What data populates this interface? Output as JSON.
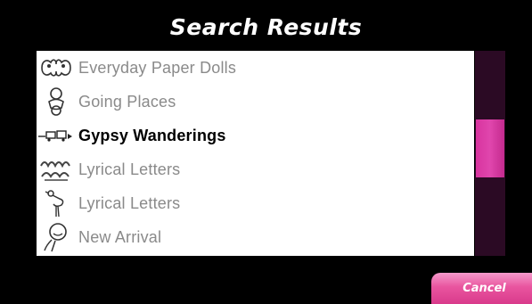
{
  "title": "Search Results",
  "results": [
    {
      "label": "Everyday Paper Dolls",
      "icon": "paper-dolls-icon"
    },
    {
      "label": "Going Places",
      "icon": "baby-icon"
    },
    {
      "label": "Gypsy Wanderings",
      "icon": "caravan-icon"
    },
    {
      "label": "Lyrical Letters",
      "icon": "baby-shower-icon"
    },
    {
      "label": "Lyrical Letters",
      "icon": "stork-icon"
    },
    {
      "label": "New Arrival",
      "icon": "baby-crawl-icon"
    }
  ],
  "selected_index": 2,
  "scroll_position": 0.45,
  "cancel_label": "Cancel",
  "colors": {
    "accent": "#d93a8b",
    "scroll_track": "#2b0a24",
    "background": "#000000"
  }
}
